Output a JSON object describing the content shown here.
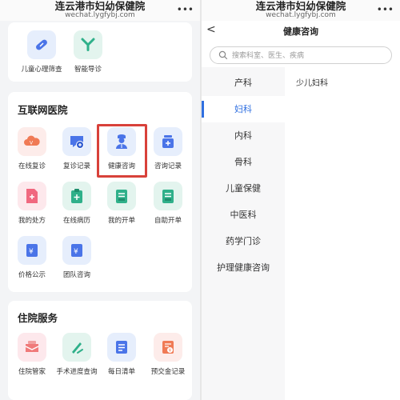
{
  "left": {
    "window_title": "连云港市妇幼保健院",
    "url": "wechat.lygfybj.com",
    "more": "•••",
    "top_items": [
      {
        "label": "儿童心理筛查",
        "icon": "pill-icon"
      },
      {
        "label": "智能导诊",
        "icon": "guide-person-icon"
      }
    ],
    "internet_hospital": {
      "title": "互联网医院",
      "items": [
        {
          "label": "在线复诊",
          "icon": "cloud-icon"
        },
        {
          "label": "复诊记录",
          "icon": "chat-plus-icon"
        },
        {
          "label": "健康咨询",
          "icon": "doctor-icon"
        },
        {
          "label": "咨询记录",
          "icon": "medicine-bottle-icon"
        },
        {
          "label": "我的处方",
          "icon": "prescription-icon"
        },
        {
          "label": "在线病历",
          "icon": "clipboard-plus-icon"
        },
        {
          "label": "我的开单",
          "icon": "document-list-icon"
        },
        {
          "label": "自助开单",
          "icon": "self-order-icon"
        },
        {
          "label": "价格公示",
          "icon": "price-tag-icon"
        },
        {
          "label": "团队咨询",
          "icon": "team-price-icon"
        }
      ]
    },
    "inpatient": {
      "title": "住院服务",
      "items": [
        {
          "label": "住院管家",
          "icon": "bed-icon"
        },
        {
          "label": "手术进度查询",
          "icon": "surgery-icon"
        },
        {
          "label": "每日清单",
          "icon": "daily-list-icon"
        },
        {
          "label": "预交金记录",
          "icon": "deposit-icon"
        }
      ]
    }
  },
  "right": {
    "window_title": "连云港市妇幼保健院",
    "url": "wechat.lygfybj.com",
    "more": "•••",
    "page_title": "健康咨询",
    "back": "<",
    "search_placeholder": "搜索科室、医生、疾病",
    "departments": [
      "产科",
      "妇科",
      "内科",
      "骨科",
      "儿童保健",
      "中医科",
      "药学门诊",
      "护理健康咨询"
    ],
    "active_department": "妇科",
    "sub_department": "少儿妇科"
  },
  "colors": {
    "accent": "#2f6fe0",
    "highlight_box": "#d8413a",
    "orange_icon": "#f07a55",
    "blue_icon": "#4a74e8",
    "green_icon": "#2fb08a",
    "pink_icon": "#f0687f"
  }
}
